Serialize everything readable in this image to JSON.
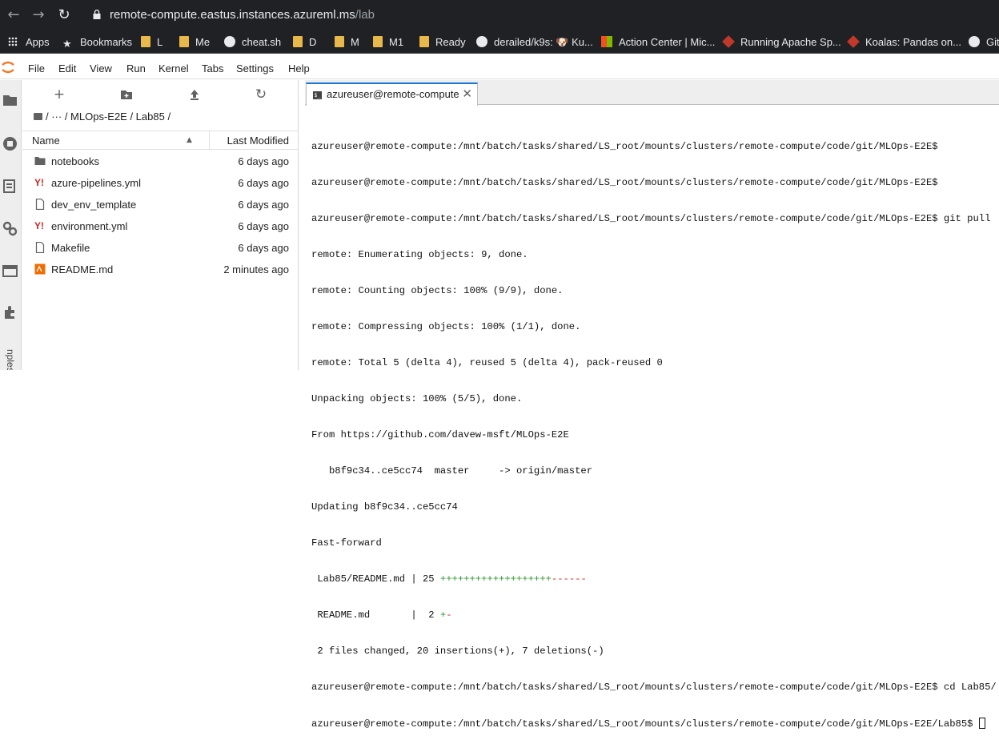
{
  "browser": {
    "url_host": "remote-compute.eastus.instances.azureml.ms",
    "url_path": "/lab",
    "bookmarks": [
      "Apps",
      "Bookmarks",
      "L",
      "Me",
      "cheat.sh",
      "D",
      "M",
      "M1",
      "Ready",
      "derailed/k9s: 🐶 Ku...",
      "Action Center | Mic...",
      "Running Apache Sp...",
      "Koalas: Pandas on...",
      "Git"
    ]
  },
  "menubar": {
    "items": [
      "File",
      "Edit",
      "View",
      "Run",
      "Kernel",
      "Tabs",
      "Settings",
      "Help"
    ]
  },
  "sidebar": {
    "bottom_label": "nples"
  },
  "filebrowser": {
    "breadcrumb": "/   ···   / MLOps-E2E / Lab85 /",
    "header_name": "Name",
    "header_sort": "▲",
    "header_modified": "Last Modified",
    "files": [
      {
        "name": "notebooks",
        "modified": "6 days ago",
        "icon": "folder-icon"
      },
      {
        "name": "azure-pipelines.yml",
        "modified": "6 days ago",
        "icon": "yaml-icon"
      },
      {
        "name": "dev_env_template",
        "modified": "6 days ago",
        "icon": "file-icon"
      },
      {
        "name": "environment.yml",
        "modified": "6 days ago",
        "icon": "yaml-icon"
      },
      {
        "name": "Makefile",
        "modified": "6 days ago",
        "icon": "file-icon"
      },
      {
        "name": "README.md",
        "modified": "2 minutes ago",
        "icon": "markdown-icon"
      }
    ]
  },
  "terminal": {
    "tab_label": "azureuser@remote-compute",
    "tab_icon_text": "$_",
    "close": "✕",
    "lines": [
      "azureuser@remote-compute:/mnt/batch/tasks/shared/LS_root/mounts/clusters/remote-compute/code/git/MLOps-E2E$",
      "azureuser@remote-compute:/mnt/batch/tasks/shared/LS_root/mounts/clusters/remote-compute/code/git/MLOps-E2E$",
      "azureuser@remote-compute:/mnt/batch/tasks/shared/LS_root/mounts/clusters/remote-compute/code/git/MLOps-E2E$ git pull",
      "remote: Enumerating objects: 9, done.",
      "remote: Counting objects: 100% (9/9), done.",
      "remote: Compressing objects: 100% (1/1), done.",
      "remote: Total 5 (delta 4), reused 5 (delta 4), pack-reused 0",
      "Unpacking objects: 100% (5/5), done.",
      "From https://github.com/davew-msft/MLOps-E2E",
      "   b8f9c34..ce5cc74  master     -> origin/master",
      "Updating b8f9c34..ce5cc74",
      "Fast-forward"
    ],
    "diff_file1": " Lab85/README.md | 25 ",
    "diff_file1_plus": "+++++++++++++++++++",
    "diff_file1_minus": "------",
    "diff_file2": " README.md       |  2 ",
    "diff_file2_plus": "+",
    "diff_file2_minus": "-",
    "summary": " 2 files changed, 20 insertions(+), 7 deletions(-)",
    "cd_line": "azureuser@remote-compute:/mnt/batch/tasks/shared/LS_root/mounts/clusters/remote-compute/code/git/MLOps-E2E$ cd Lab85/",
    "final_prompt": "azureuser@remote-compute:/mnt/batch/tasks/shared/LS_root/mounts/clusters/remote-compute/code/git/MLOps-E2E/Lab85$ "
  }
}
